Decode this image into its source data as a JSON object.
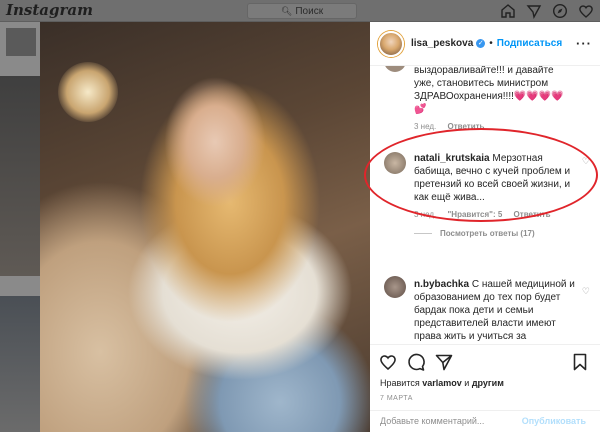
{
  "topnav": {
    "logo": "Instagram",
    "search_placeholder": "Поиск",
    "icons": [
      "home-icon",
      "direct-icon",
      "explore-icon",
      "heart-icon"
    ]
  },
  "post": {
    "author": "lisa_peskova",
    "verified": true,
    "follow_label": "Подписаться",
    "more": "···"
  },
  "comments": [
    {
      "username": "",
      "text": "выздоравливайте!!! и давайте уже, становитесь министром ЗДРАВОохранения!!!!",
      "emoji": "💗💗💗💗💕",
      "time": "3 нед.",
      "reply_label": "Ответить"
    },
    {
      "username": "natali_krutskaia",
      "text": "Мерзотная бабища, вечно с кучей проблем и претензий ко всей своей жизни, и как ещё жива...",
      "time": "3 нед.",
      "likes": "\"Нравится\": 5",
      "reply_label": "Ответить",
      "view_replies": "Посмотреть ответы (17)"
    },
    {
      "username": "n.bybachka",
      "text": "С нашей медициной и образованием до тех пор будет бардак пока дети и семьи представителей власти имеют права жить и учиться за"
    }
  ],
  "footer": {
    "liked_by_prefix": "Нравится",
    "liked_by_user": "varlamov",
    "liked_by_suffix": "и",
    "liked_by_others": "другим",
    "date": "7 МАРТА",
    "comment_placeholder": "Добавьте комментарий...",
    "publish_label": "Опубликовать"
  },
  "colors": {
    "accent": "#0095f6",
    "annotation": "#e0252b"
  }
}
